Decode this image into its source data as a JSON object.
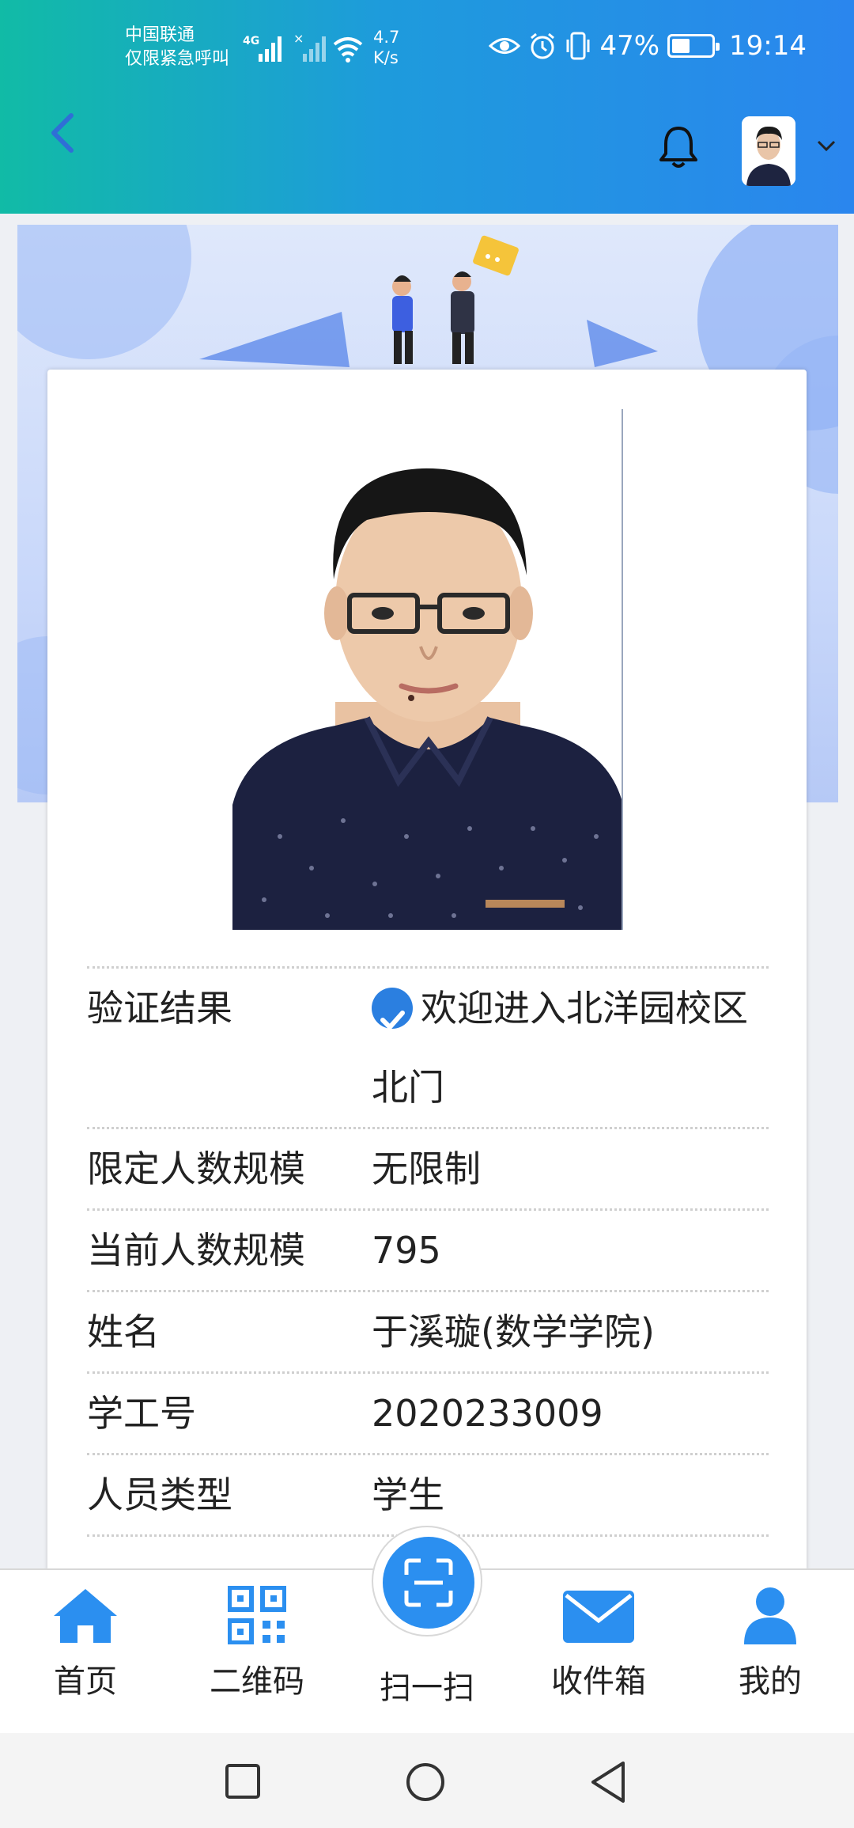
{
  "status_bar": {
    "carrier_line1": "中国联通",
    "carrier_line2": "仅限紧急呼叫",
    "net_speed_value": "4.7",
    "net_speed_unit": "K/s",
    "battery": "47%",
    "time": "19:14",
    "icons": [
      "signal-4g-icon",
      "signal-no-sim-icon",
      "wifi-icon",
      "eye-icon",
      "alarm-icon",
      "vibrate-icon",
      "battery-icon"
    ]
  },
  "header": {
    "back_icon": "chevron-left-icon",
    "bell_icon": "bell-icon",
    "avatar_caret_icon": "chevron-down-icon"
  },
  "card": {
    "rows": [
      {
        "label": "验证结果",
        "value_line1": "欢迎进入北洋园校区",
        "value_line2": "北门",
        "icon": "check-circle-icon"
      },
      {
        "label": "限定人数规模",
        "value": "无限制"
      },
      {
        "label": "当前人数规模",
        "value": "795"
      },
      {
        "label": "姓名",
        "value": "于溪璇(数学学院)"
      },
      {
        "label": "学工号",
        "value": "2020233009"
      },
      {
        "label": "人员类型",
        "value": "学生"
      }
    ]
  },
  "bottom_nav": {
    "items": [
      {
        "label": "首页",
        "icon": "home-icon"
      },
      {
        "label": "二维码",
        "icon": "qr-code-icon"
      },
      {
        "label": "扫一扫",
        "icon": "scan-icon"
      },
      {
        "label": "收件箱",
        "icon": "mail-icon"
      },
      {
        "label": "我的",
        "icon": "user-icon"
      }
    ]
  },
  "system_nav": [
    "square-icon",
    "circle-icon",
    "triangle-back-icon"
  ],
  "colors": {
    "header_start": "#11bba6",
    "header_end": "#2a86ee",
    "accent": "#2b8ff0",
    "check": "#2b7fe0"
  }
}
